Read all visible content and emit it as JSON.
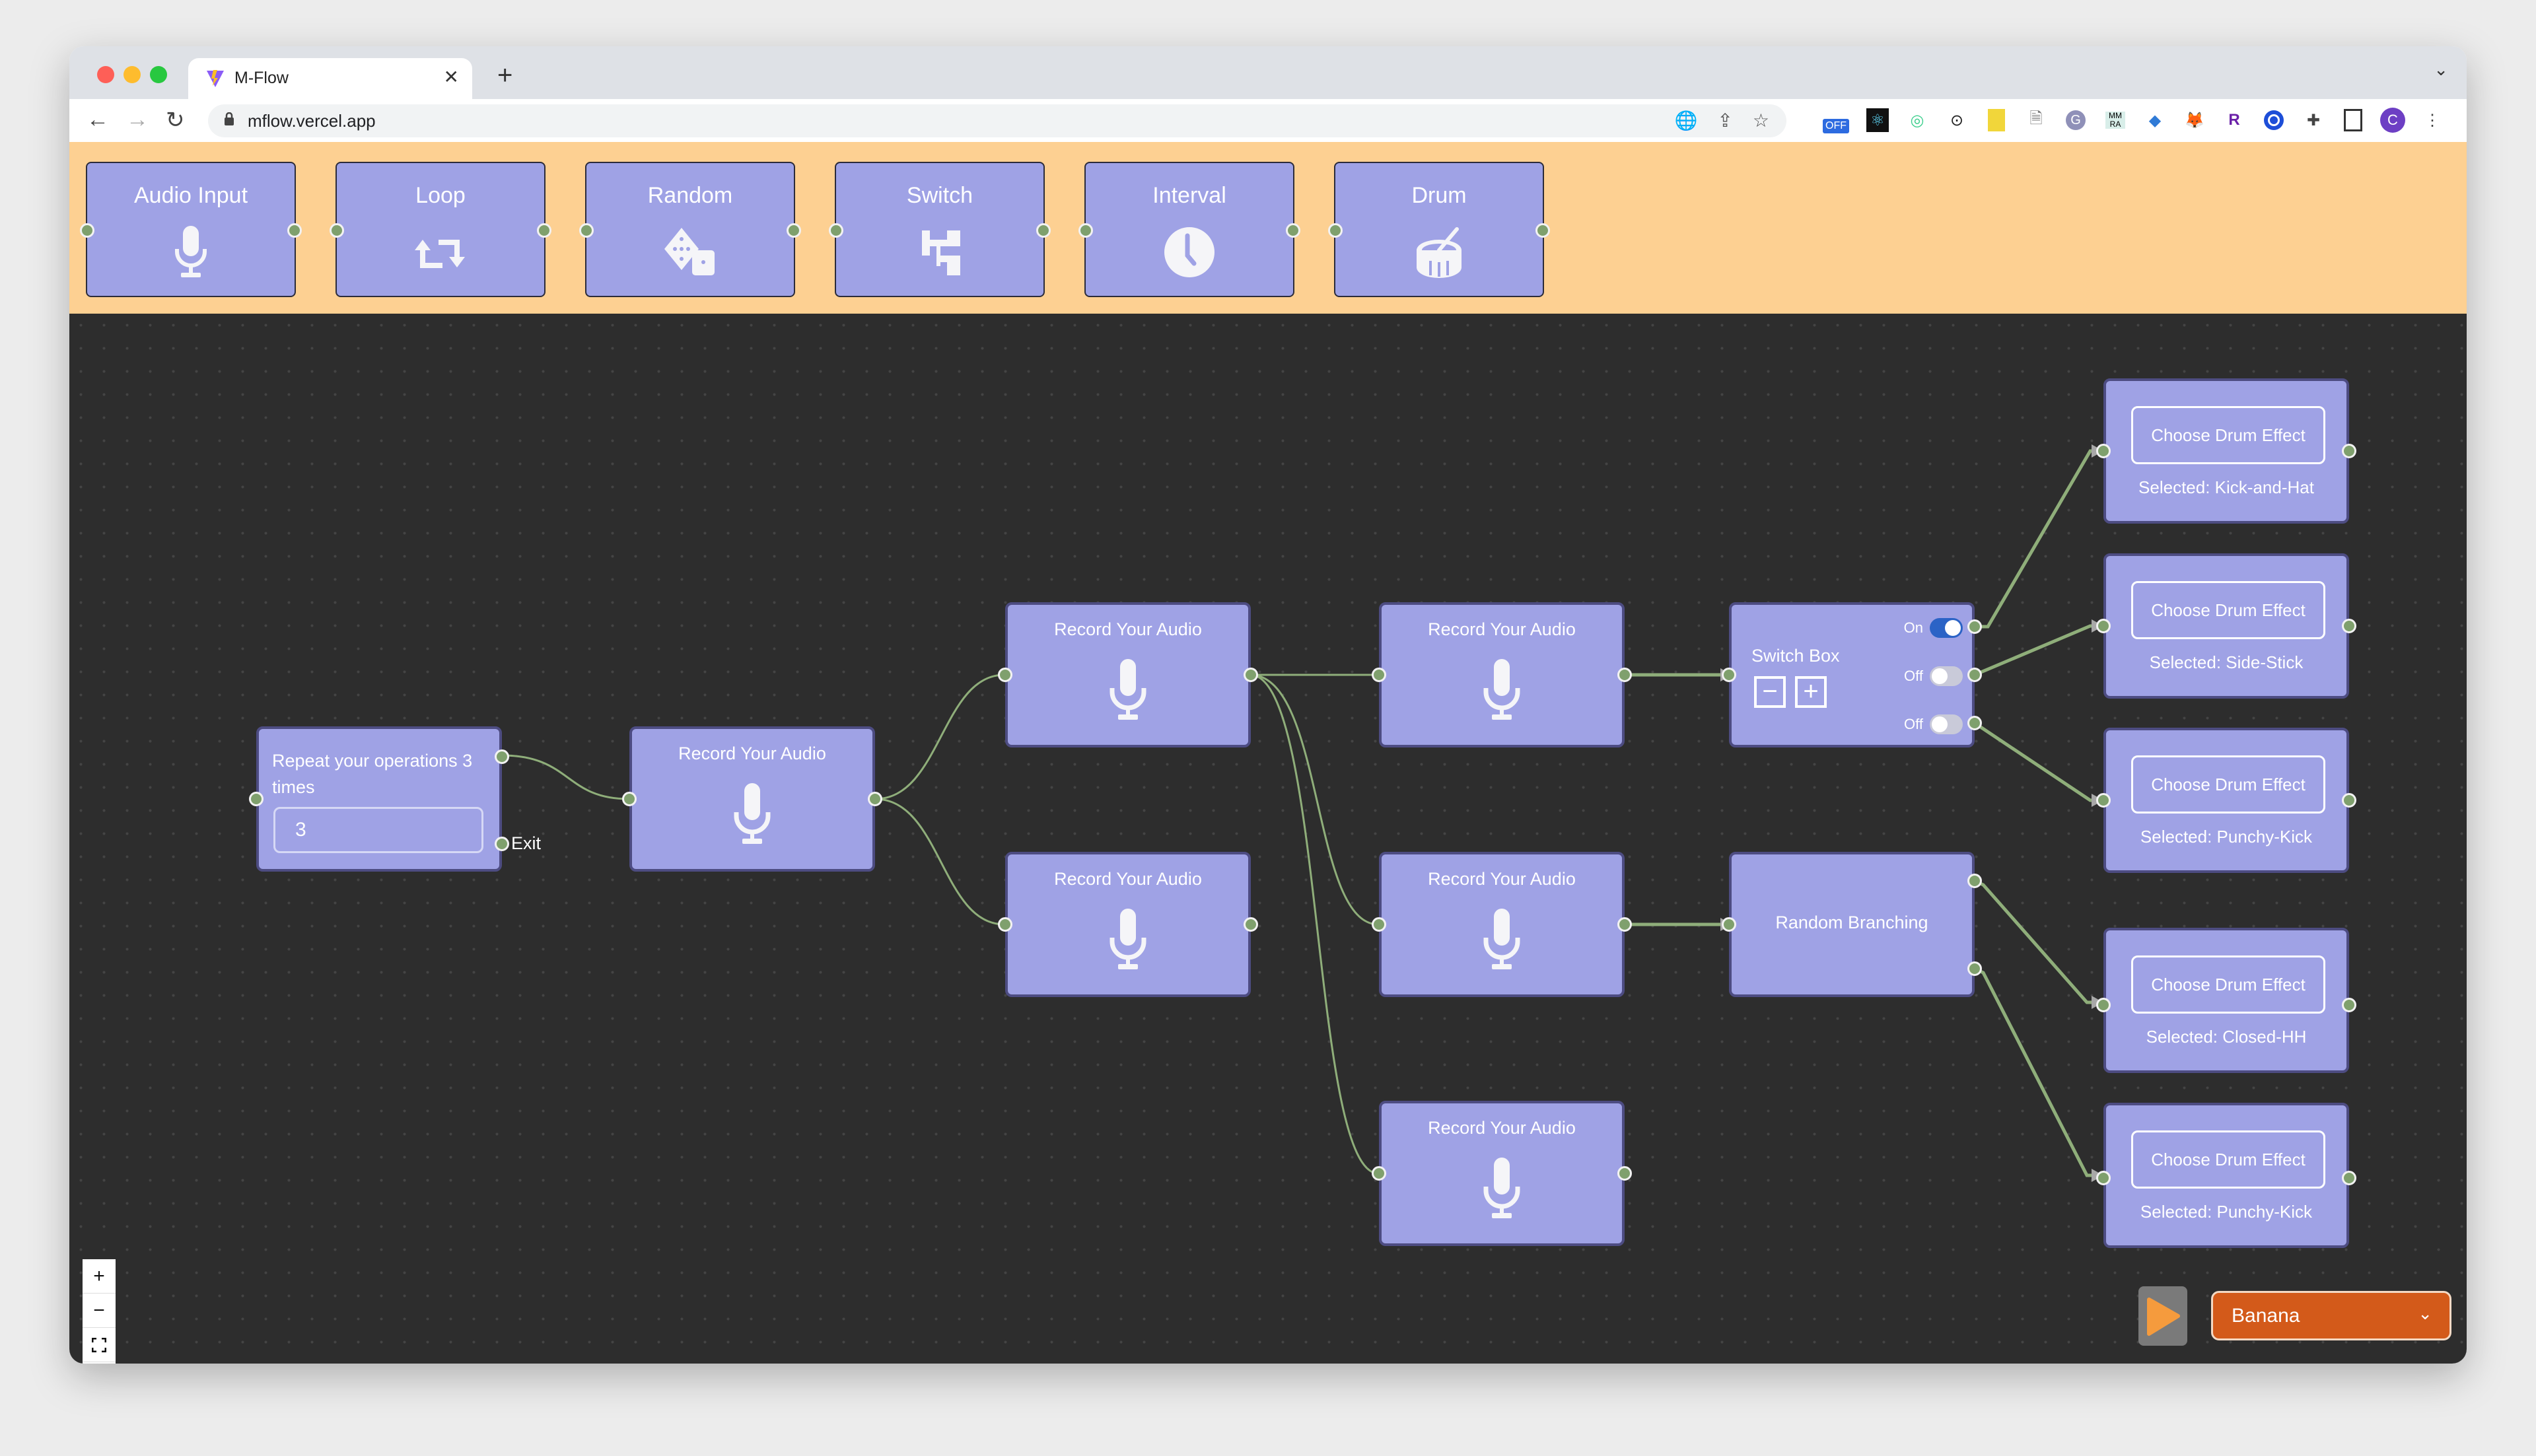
{
  "browser": {
    "tab_title": "M-Flow",
    "url": "mflow.vercel.app",
    "extensions": [
      "translate-icon",
      "share-icon",
      "star-icon",
      "off-badge-ext",
      "react-devtools-ext",
      "circle-ext",
      "braces-ext",
      "yellow-note-ext",
      "doc-ext",
      "g-ext",
      "mmra-ext",
      "blue-drop-ext",
      "metamask-ext",
      "r-ext",
      "target-ext",
      "puzzle-icon",
      "sidebar-icon",
      "profile-avatar"
    ],
    "off_badge": "OFF",
    "mmra_text": "MM RA",
    "profile_initial": "C",
    "r_text": "R"
  },
  "palette": {
    "items": [
      {
        "label": "Audio Input",
        "icon": "microphone-icon"
      },
      {
        "label": "Loop",
        "icon": "repeat-icon"
      },
      {
        "label": "Random",
        "icon": "dice-icon"
      },
      {
        "label": "Switch",
        "icon": "switch-branch-icon"
      },
      {
        "label": "Interval",
        "icon": "clock-icon"
      },
      {
        "label": "Drum",
        "icon": "drum-icon"
      }
    ]
  },
  "graph": {
    "loop_node": {
      "title": "Repeat your operations 3 times",
      "input_value": "3",
      "exit_label": "Exit"
    },
    "record_nodes": [
      {
        "title": "Record Your Audio"
      },
      {
        "title": "Record Your Audio"
      },
      {
        "title": "Record Your Audio"
      },
      {
        "title": "Record Your Audio"
      },
      {
        "title": "Record Your Audio"
      },
      {
        "title": "Record Your Audio"
      }
    ],
    "switch_node": {
      "title": "Switch Box",
      "minus": "−",
      "plus": "+",
      "toggles": [
        {
          "label": "On",
          "on": true
        },
        {
          "label": "Off",
          "on": false
        },
        {
          "label": "Off",
          "on": false
        }
      ]
    },
    "random_node": {
      "title": "Random Branching"
    },
    "drum_nodes": [
      {
        "button": "Choose Drum Effect",
        "selected": "Selected: Kick-and-Hat"
      },
      {
        "button": "Choose Drum Effect",
        "selected": "Selected: Side-Stick"
      },
      {
        "button": "Choose Drum Effect",
        "selected": "Selected: Punchy-Kick"
      },
      {
        "button": "Choose Drum Effect",
        "selected": "Selected: Closed-HH"
      },
      {
        "button": "Choose Drum Effect",
        "selected": "Selected: Punchy-Kick"
      }
    ]
  },
  "controls": {
    "zoom_in": "+",
    "zoom_out": "−",
    "fit": "⛶",
    "lock": "🔓"
  },
  "player": {
    "selected_option": "Banana",
    "chevron": "⌄"
  },
  "colors": {
    "palette_bg": "#fdd092",
    "node_bg": "#9fa2e5",
    "handle": "#7fa06d",
    "canvas_bg": "#2d2d2d",
    "select_bg": "#d35a1a",
    "play_icon": "#f59b3d",
    "toggle_on": "#2b63c6"
  }
}
